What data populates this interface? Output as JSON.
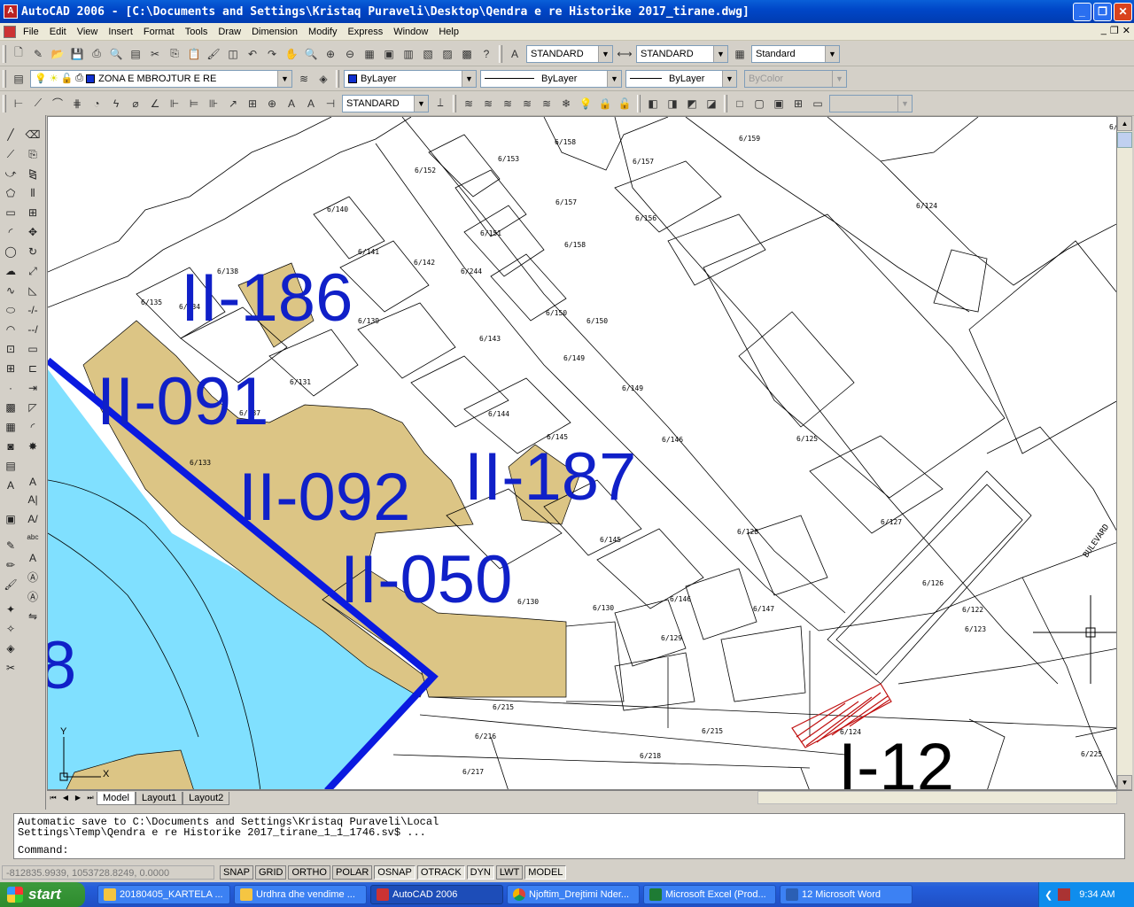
{
  "window": {
    "title": "AutoCAD 2006 - [C:\\Documents and Settings\\Kristaq Puraveli\\Desktop\\Qendra e re Historike 2017_tirane.dwg]",
    "minimize": "_",
    "restore": "❐",
    "close": "✕"
  },
  "menu": [
    "File",
    "Edit",
    "View",
    "Insert",
    "Format",
    "Tools",
    "Draw",
    "Dimension",
    "Modify",
    "Express",
    "Window",
    "Help"
  ],
  "toolbar": {
    "text_style": "STANDARD",
    "dim_style": "STANDARD",
    "table_style": "Standard",
    "layer": "ZONA E MBROJTUR E RE",
    "color": "ByLayer",
    "linetype": "ByLayer",
    "lineweight": "ByLayer",
    "plotstyle": "ByColor",
    "dim_style2": "STANDARD"
  },
  "drawing": {
    "zones": [
      "II-186",
      "II-091",
      "II-092",
      "II-187",
      "II-050",
      "I-12",
      "8"
    ],
    "parcels": [
      "6/158",
      "6/159",
      "6/153",
      "6/157",
      "6/152",
      "6/157",
      "6/156",
      "6/124",
      "6/140",
      "6/151",
      "6/158",
      "6/141",
      "6/142",
      "6/244",
      "6/138",
      "6/135",
      "6/134",
      "6/139",
      "6/150",
      "6/150",
      "6/143",
      "6/149",
      "6/131",
      "6/137",
      "6/149",
      "6/144",
      "6/146",
      "6/125",
      "6/145",
      "6/133",
      "6/127",
      "6/128",
      "6/145",
      "6/126",
      "6/130",
      "6/130",
      "6/146",
      "6/147",
      "6/122",
      "6/123",
      "6/129",
      "6/215",
      "6/215",
      "6/124",
      "6/216",
      "6/218",
      "6/217",
      "6/225",
      "6/"
    ],
    "street": "BULEVARD",
    "ucs_x": "X",
    "ucs_y": "Y"
  },
  "tabs": [
    "Model",
    "Layout1",
    "Layout2"
  ],
  "command": {
    "lines": [
      "Automatic save to C:\\Documents and Settings\\Kristaq Puraveli\\Local",
      "Settings\\Temp\\Qendra e re Historike 2017_tirane_1_1_1746.sv$ ...",
      "Command:"
    ]
  },
  "status": {
    "coords": "-812835.9939, 1053728.8249, 0.0000",
    "buttons": [
      "SNAP",
      "GRID",
      "ORTHO",
      "POLAR",
      "OSNAP",
      "OTRACK",
      "DYN",
      "LWT",
      "MODEL"
    ]
  },
  "taskbar": {
    "start": "start",
    "tasks": [
      "20180405_KARTELA ...",
      "Urdhra dhe vendime ...",
      "AutoCAD 2006",
      "Njoftim_Drejtimi Nder...",
      "Microsoft Excel (Prod...",
      "12 Microsoft Word"
    ],
    "clock": "9:34 AM"
  },
  "colors": {
    "zone_fill": "#dcc585",
    "water": "#80e0ff",
    "boundary": "#0a1ae0",
    "zone_label": "#1020c8",
    "hatch": "#c01010"
  }
}
